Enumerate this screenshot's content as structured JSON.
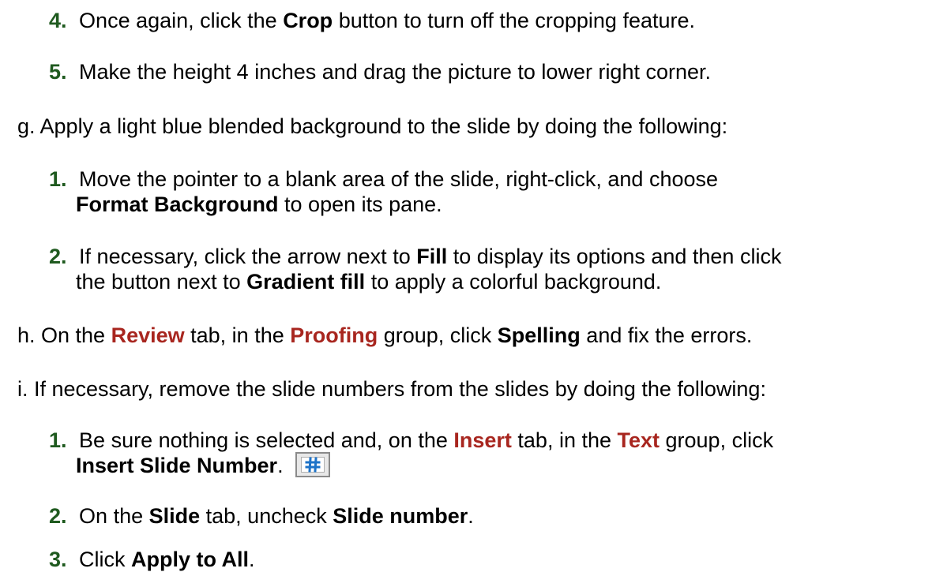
{
  "colors": {
    "step_number": "#1f5a1f",
    "ribbon_name": "#a8261f",
    "icon_blue": "#1e73c8"
  },
  "items": [
    {
      "num": "4.",
      "t1": "Once again, click the ",
      "b1": "Crop",
      "t2": " button to turn off the cropping feature."
    },
    {
      "num": "5.",
      "t1": "Make the height 4 inches and drag the picture to lower right corner."
    },
    {
      "t1": "g. Apply a light blue blended background to the slide by doing the following:"
    },
    {
      "num": "1.",
      "t1": "Move the pointer to a blank area of the slide, right-click, and choose"
    },
    {
      "b1": "Format Background",
      "t2": " to open its pane."
    },
    {
      "num": "2.",
      "t1": "If necessary, click the arrow next to ",
      "b1": "Fill",
      "t2": " to display its options and then click"
    },
    {
      "t1": "the button next to ",
      "b1": "Gradient fill",
      "t2": " to apply a colorful background."
    },
    {
      "t1": "h. On the ",
      "r1": "Review",
      "t2": " tab, in the ",
      "r2": "Proofing",
      "t3": " group, click ",
      "b1": "Spelling",
      "t4": " and fix the errors."
    },
    {
      "t1": "i.  If necessary, remove the slide numbers from the slides by doing the following:"
    },
    {
      "num": "1.",
      "t1": "Be sure nothing is selected and, on the ",
      "r1": "Insert",
      "t2": " tab, in the ",
      "r2": "Text",
      "t3": " group, click"
    },
    {
      "b1": "Insert Slide Number",
      "t2": ".",
      "icon": "slide-number-icon"
    },
    {
      "num": "2.",
      "t1": "On the ",
      "b1": "Slide",
      "t2": " tab, uncheck ",
      "b2": "Slide number",
      "t3": "."
    },
    {
      "num": "3.",
      "t1": "Click ",
      "b1": "Apply to All",
      "t2": "."
    }
  ]
}
